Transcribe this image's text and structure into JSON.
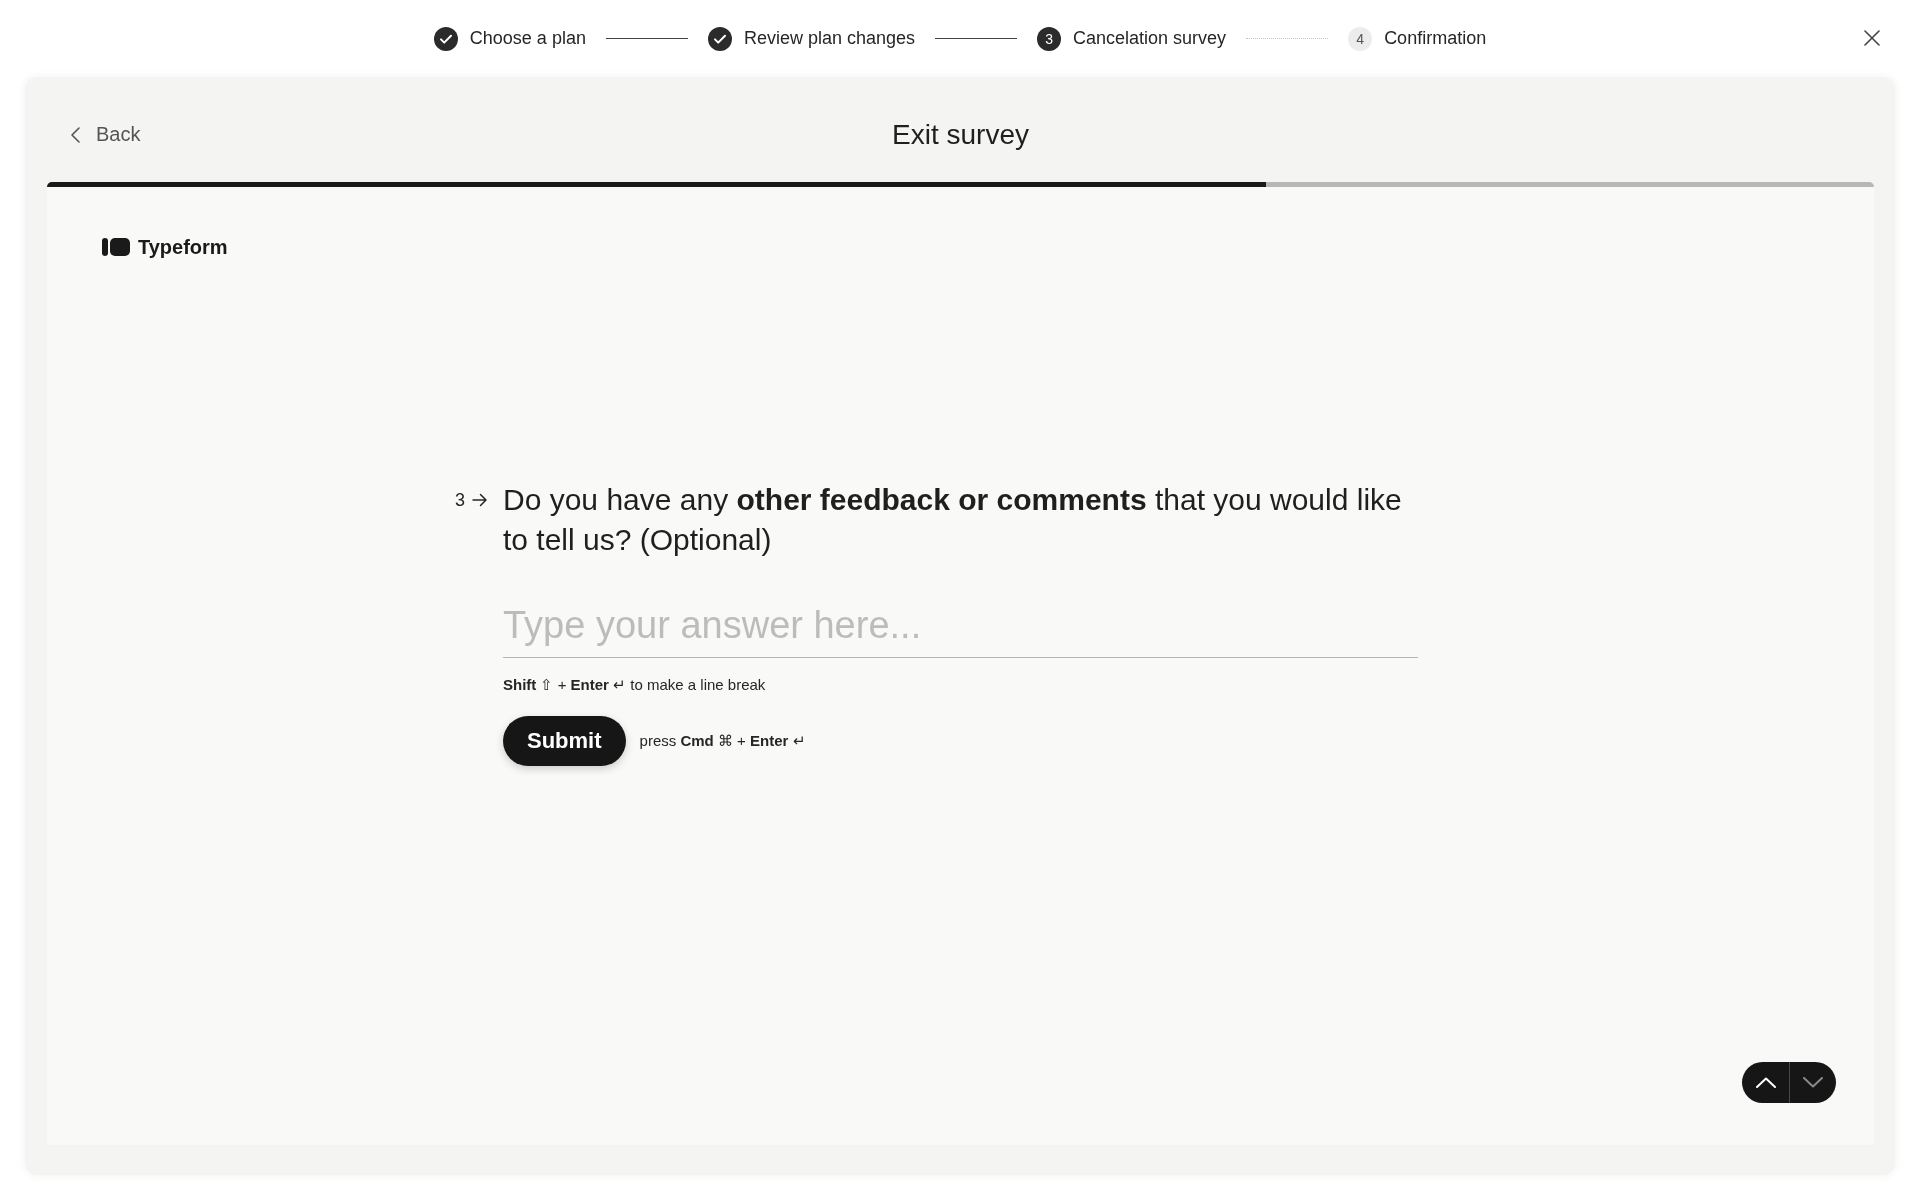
{
  "stepper": {
    "steps": [
      {
        "label": "Choose a plan",
        "kind": "completed"
      },
      {
        "label": "Review plan changes",
        "kind": "completed"
      },
      {
        "number": "3",
        "label": "Cancelation survey",
        "kind": "current"
      },
      {
        "number": "4",
        "label": "Confirmation",
        "kind": "upcoming"
      }
    ]
  },
  "header": {
    "back_label": "Back",
    "title": "Exit survey"
  },
  "progress": {
    "level": 0.667
  },
  "form": {
    "brand": "Typeform",
    "question": {
      "number": "3",
      "text": "Do you have any **other feedback or comments** that you would like to tell us? (Optional)"
    },
    "answer": {
      "placeholder": "Type your answer here..."
    },
    "hint": "**Shift** ⇧ + **Enter** ↵ to make a line break",
    "submit": {
      "label": "Submit",
      "hint": "press **Cmd** ⌘ + **Enter** ↵"
    }
  },
  "navigation": {
    "up": {
      "disabled": false
    },
    "down": {
      "disabled": true
    }
  }
}
